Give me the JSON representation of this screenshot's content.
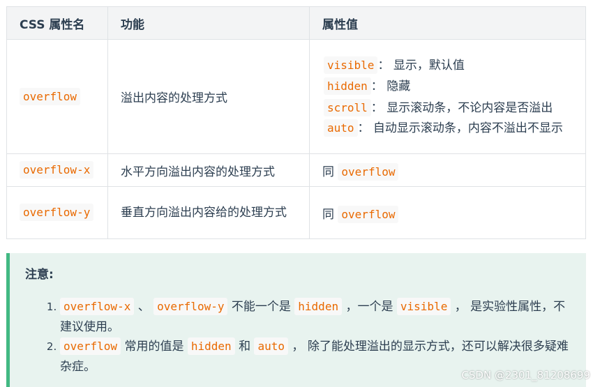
{
  "table": {
    "headers": [
      "CSS 属性名",
      "功能",
      "属性值"
    ],
    "rows": [
      {
        "name": "overflow",
        "function": "溢出内容的处理方式",
        "values": [
          {
            "code": "visible",
            "desc": "： 显示，默认值"
          },
          {
            "code": "hidden",
            "desc": "： 隐藏"
          },
          {
            "code": "scroll",
            "desc": "： 显示滚动条，不论内容是否溢出"
          },
          {
            "code": "auto",
            "desc": "： 自动显示滚动条，内容不溢出不显示"
          }
        ]
      },
      {
        "name": "overflow-x",
        "function": "水平方向溢出内容的处理方式",
        "same_prefix": "同",
        "same_code": "overflow"
      },
      {
        "name": "overflow-y",
        "function": "垂直方向溢出内容给的处理方式",
        "same_prefix": "同",
        "same_code": "overflow"
      }
    ]
  },
  "note": {
    "title": "注意:",
    "items": [
      {
        "code1": "overflow-x",
        "sep": " 、 ",
        "code2": "overflow-y",
        "text1": " 不能一个是 ",
        "code3": "hidden",
        "text2": " ，一个是 ",
        "code4": "visible",
        "text3": " ， 是实验性属性，不建议使用。"
      },
      {
        "code1": "overflow",
        "text1": " 常用的值是 ",
        "code2": "hidden",
        "text2": " 和 ",
        "code3": "auto",
        "text3": " ， 除了能处理溢出的显示方式，还可以解决很多疑难杂症。"
      }
    ]
  },
  "watermark": "CSDN @2301_81208699",
  "colors": {
    "code_text": "#e96900",
    "note_border": "#42b983",
    "note_bg": "#e8f3ef",
    "header_bg": "#f3f4f5"
  }
}
